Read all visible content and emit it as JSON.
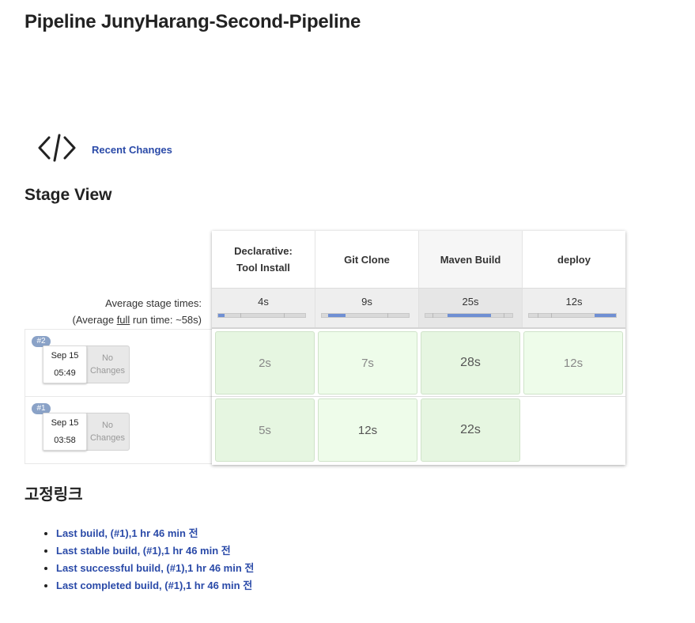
{
  "page": {
    "title": "Pipeline JunyHarang-Second-Pipeline"
  },
  "recent_changes": {
    "label": "Recent Changes",
    "icon": "code-brackets-icon"
  },
  "stage_view": {
    "title": "Stage View",
    "avg_label": "Average stage times:",
    "avg_full_prefix": "(Average ",
    "avg_full_link": "full",
    "avg_full_suffix": " run time: ~58s)",
    "stages": [
      {
        "name": "Declarative:",
        "name2": "Tool Install",
        "avg": "4s",
        "avg_fraction": 0.07
      },
      {
        "name": "Git Clone",
        "name2": "",
        "avg": "9s",
        "avg_fraction": 0.2
      },
      {
        "name": "Maven Build",
        "name2": "",
        "avg": "25s",
        "avg_fraction": 0.5
      },
      {
        "name": "deploy",
        "name2": "",
        "avg": "12s",
        "avg_fraction": 0.25
      }
    ],
    "builds": [
      {
        "number": "#2",
        "date": "Sep 15",
        "time": "05:49",
        "changes_line1": "No",
        "changes_line2": "Changes",
        "durations": [
          "2s",
          "7s",
          "28s",
          "12s"
        ]
      },
      {
        "number": "#1",
        "date": "Sep 15",
        "time": "03:58",
        "changes_line1": "No",
        "changes_line2": "Changes",
        "durations": [
          "5s",
          "12s",
          "22s",
          ""
        ]
      }
    ],
    "colors": {
      "success_light": "#eefcea",
      "success_mid": "#e6f6e1",
      "progress_fill": "#6f8fd3",
      "badge": "#8aa2c7"
    }
  },
  "permalinks": {
    "title": "고정링크",
    "items": [
      {
        "label": "Last build, (#1),1 hr 46 min",
        "suffix": " 전"
      },
      {
        "label": "Last stable build, (#1),1 hr 46 min",
        "suffix": " 전"
      },
      {
        "label": "Last successful build, (#1),1 hr 46 min",
        "suffix": " 전"
      },
      {
        "label": "Last completed build, (#1),1 hr 46 min",
        "suffix": " 전"
      }
    ]
  }
}
